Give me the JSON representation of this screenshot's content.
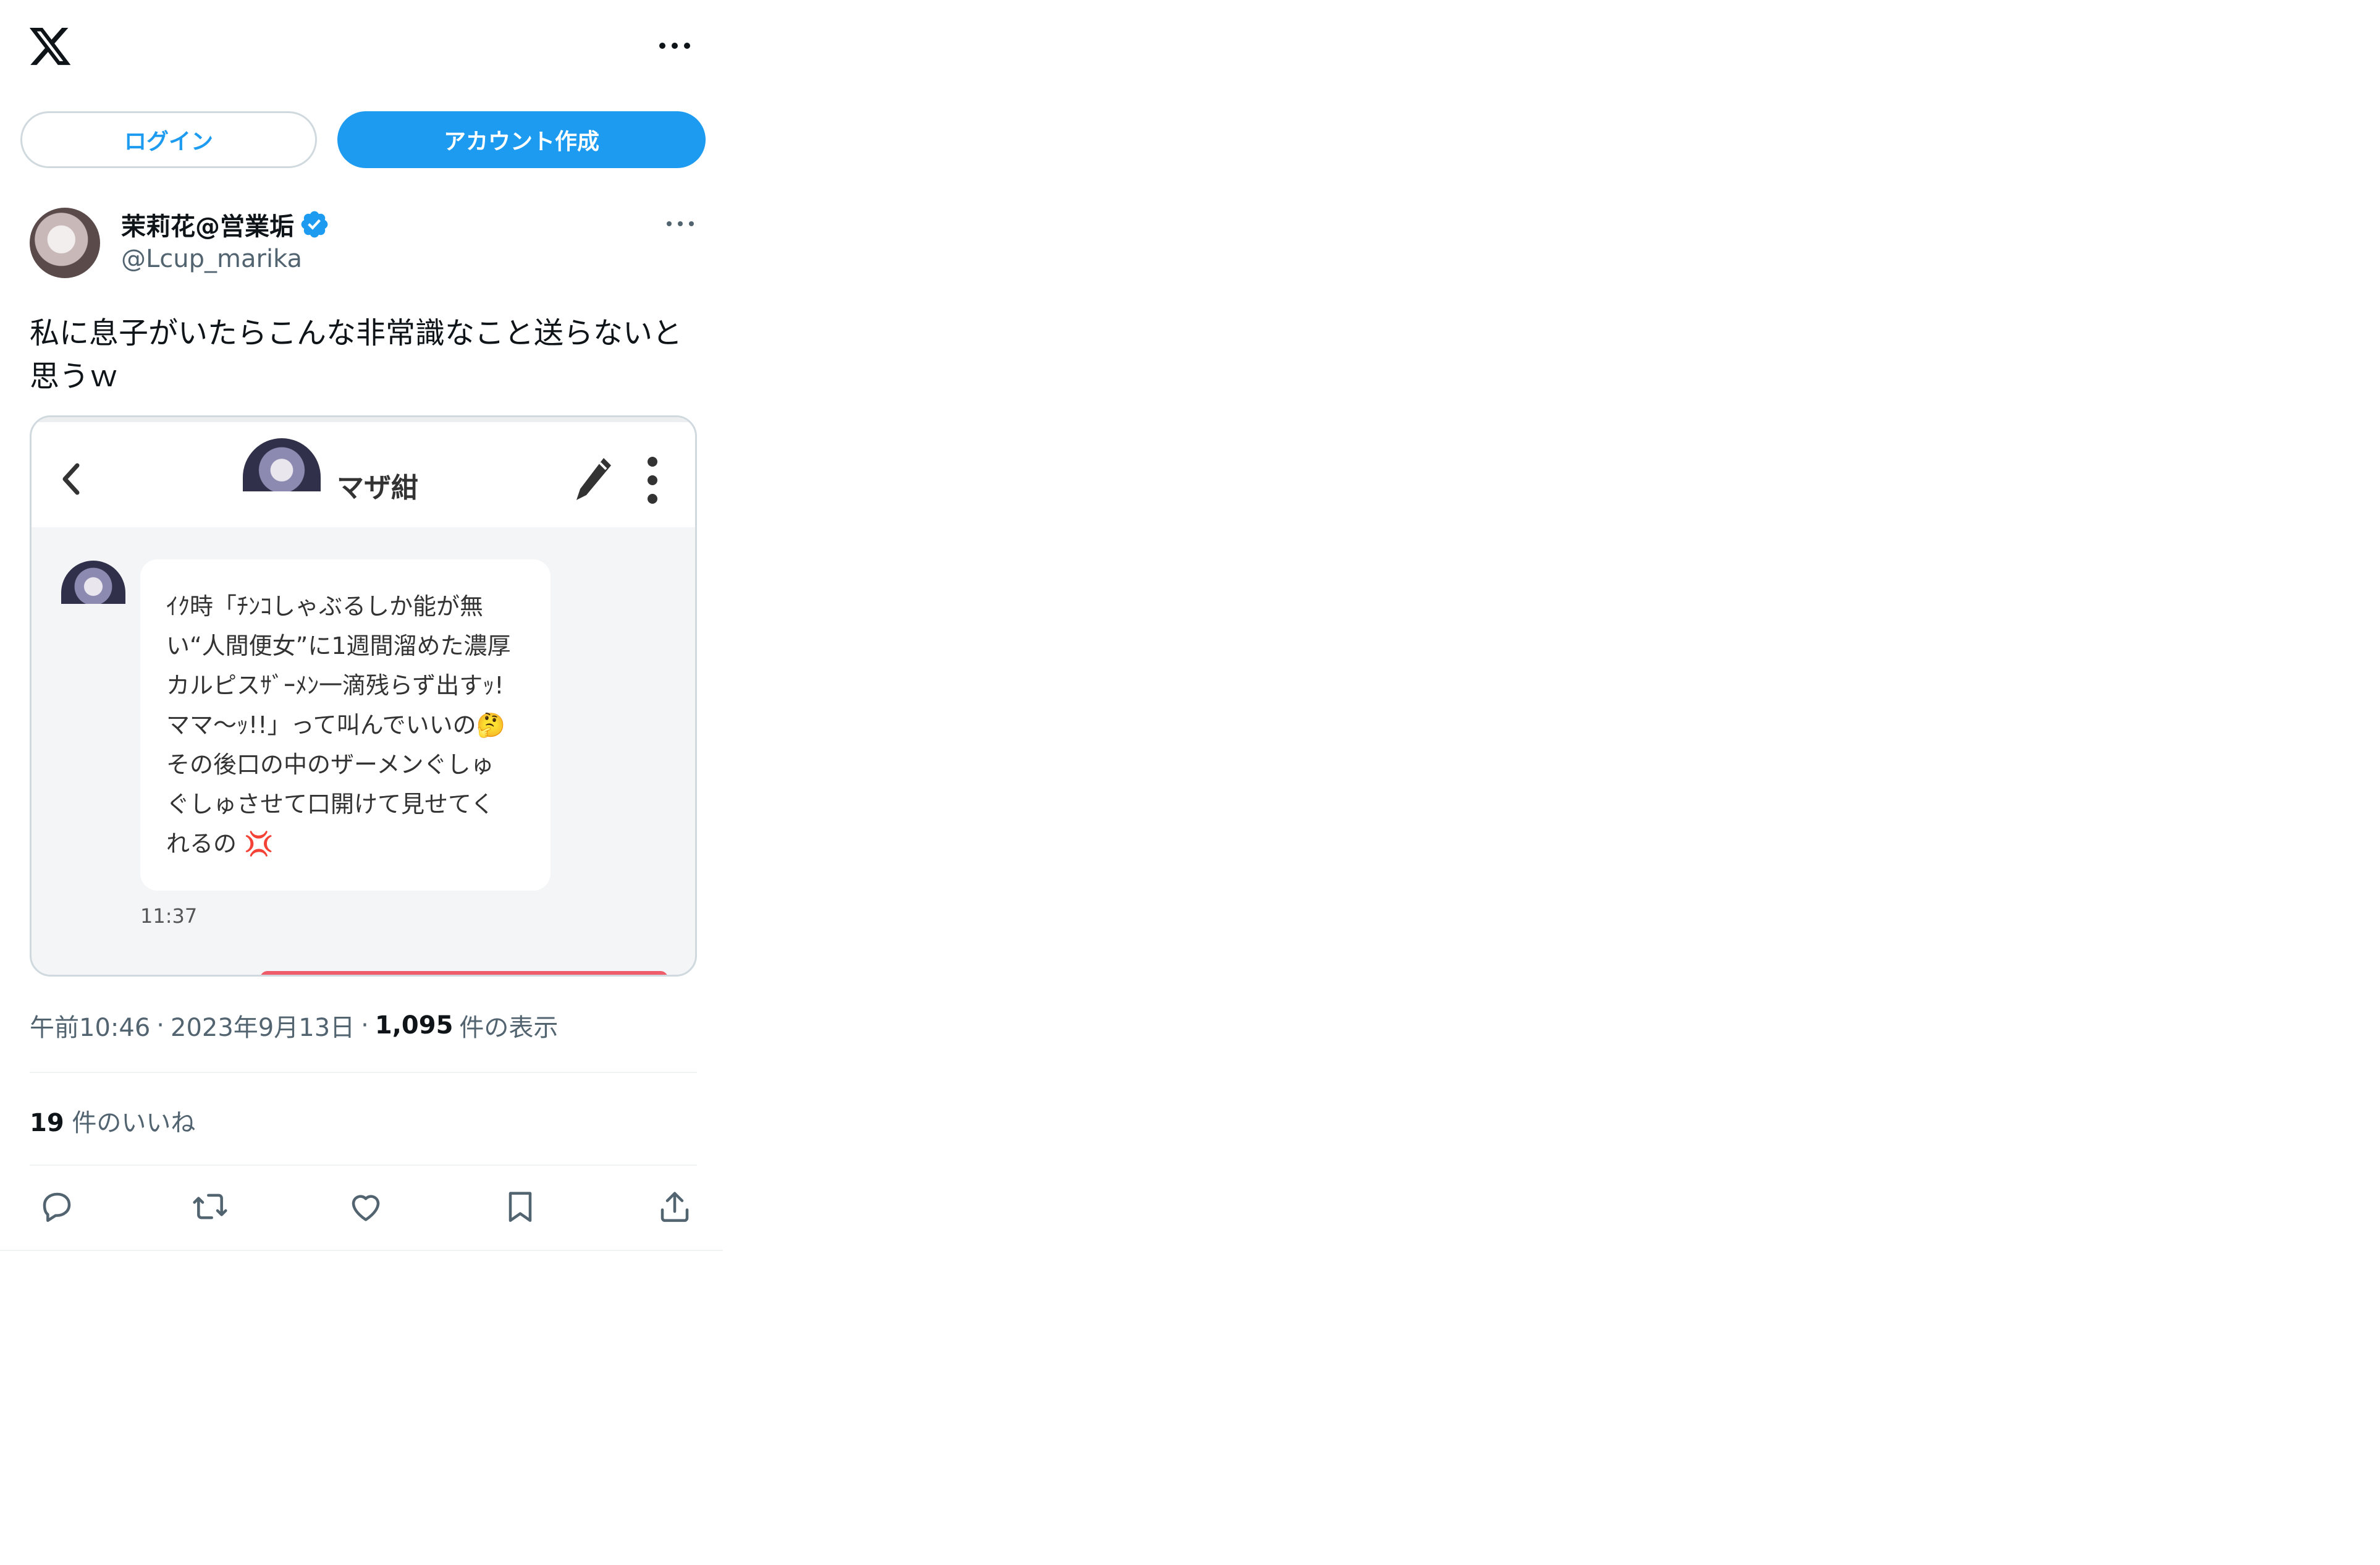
{
  "header": {
    "logo_icon": "x-logo-icon",
    "more_icon": "more-horizontal-icon"
  },
  "auth": {
    "login_label": "ログイン",
    "signup_label": "アカウント作成",
    "accent_color": "#1d9bf0"
  },
  "tweet": {
    "author": {
      "display_name": "茉莉花@営業垢",
      "handle": "@Lcup_marika",
      "verified": true
    },
    "text_lines": [
      "私に息子がいたらこんな非常識なこと送らないと",
      "思うｗ"
    ],
    "media": {
      "chat_title": "マザ紺",
      "message_lines": [
        "ｲｸ時「ﾁﾝｺしゃぶるしか能が無",
        "い“人間便女”に1週間溜めた濃厚",
        "カルピスｻﾞｰﾒﾝ一滴残らず出すｯ!",
        "ママ〜ｯ!!」って叫んでいいの🤔",
        "その後口の中のザーメンぐしゅ",
        "ぐしゅさせて口開けて見せてく",
        "れるの 💢"
      ],
      "message_time": "11:37"
    },
    "meta": {
      "time": "午前10:46",
      "separator": "·",
      "date": "2023年9月13日",
      "views_count": "1,095",
      "views_label": "件の表示"
    },
    "likes": {
      "count": "19",
      "label": "件のいいね"
    },
    "actions": [
      "reply-icon",
      "retweet-icon",
      "like-icon",
      "bookmark-icon",
      "share-icon"
    ]
  }
}
